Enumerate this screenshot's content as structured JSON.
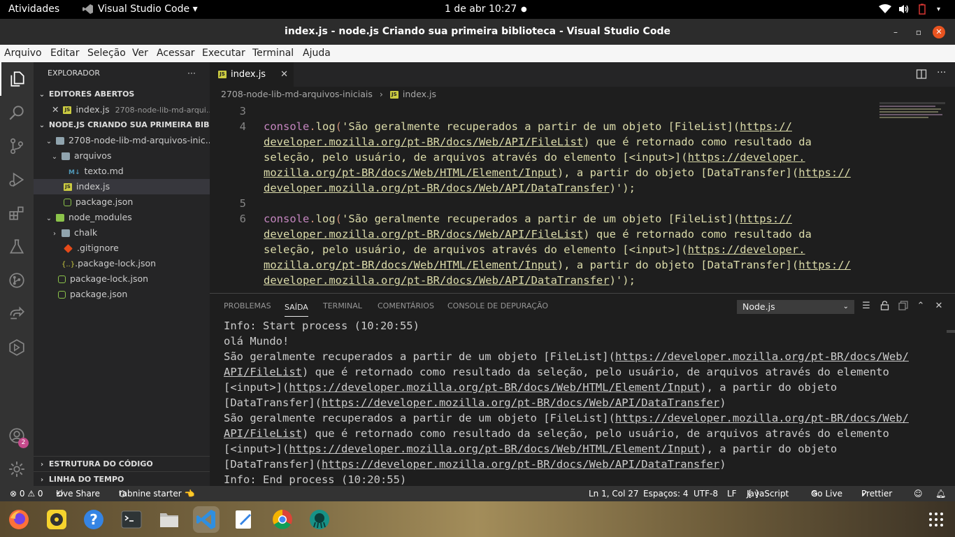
{
  "topbar": {
    "activities": "Atividades",
    "app_menu": "Visual Studio Code",
    "clock": "1 de abr  10:27"
  },
  "window": {
    "title": "index.js - node.js Criando sua primeira biblioteca - Visual Studio Code"
  },
  "menu": [
    "Arquivo",
    "Editar",
    "Seleção",
    "Ver",
    "Acessar",
    "Executar",
    "Terminal",
    "Ajuda"
  ],
  "activity_bar": {
    "accounts_badge": "2"
  },
  "sidebar": {
    "header": "EXPLORADOR",
    "more": "···",
    "open_editors_title": "EDITORES ABERTOS",
    "open_editor": {
      "name": "index.js",
      "path": "2708-node-lib-md-arqui..."
    },
    "project_title": "NODE.JS CRIANDO SUA PRIMEIRA BIBLIO...",
    "tree": [
      {
        "label": "2708-node-lib-md-arquivos-inic...",
        "kind": "folder",
        "depth": 1,
        "open": true
      },
      {
        "label": "arquivos",
        "kind": "folder",
        "depth": 2,
        "open": true
      },
      {
        "label": "texto.md",
        "kind": "md",
        "depth": 3
      },
      {
        "label": "index.js",
        "kind": "js",
        "depth": 2,
        "selected": true
      },
      {
        "label": "package.json",
        "kind": "npm",
        "depth": 2
      },
      {
        "label": "node_modules",
        "kind": "folder",
        "depth": 1,
        "open": true
      },
      {
        "label": "chalk",
        "kind": "folder",
        "depth": 2,
        "open": false
      },
      {
        "label": ".gitignore",
        "kind": "git",
        "depth": 2
      },
      {
        "label": ".package-lock.json",
        "kind": "jsonlock",
        "depth": 2
      },
      {
        "label": "package-lock.json",
        "kind": "npm",
        "depth": 1
      },
      {
        "label": "package.json",
        "kind": "npm",
        "depth": 1
      }
    ],
    "outline_title": "ESTRUTURA DO CÓDIGO",
    "timeline_title": "LINHA DO TEMPO"
  },
  "editor": {
    "tab": "index.js",
    "breadcrumb": {
      "folder": "2708-node-lib-md-arquivos-iniciais",
      "file": "index.js"
    },
    "lines": [
      {
        "num": "3",
        "text": ""
      },
      {
        "num": "4",
        "text": "console.log('São geralmente recuperados a partir de um objeto [FileList](https://",
        "first": true
      },
      {
        "num": "",
        "text": "developer.mozilla.org/pt-BR/docs/Web/API/FileList) que é retornado como resultado da"
      },
      {
        "num": "",
        "text": "seleção, pelo usuário, de arquivos através do elemento [<input>](https://developer."
      },
      {
        "num": "",
        "text": "mozilla.org/pt-BR/docs/Web/HTML/Element/Input), a partir do objeto [DataTransfer](https://"
      },
      {
        "num": "",
        "text": "developer.mozilla.org/pt-BR/docs/Web/API/DataTransfer)');"
      },
      {
        "num": "5",
        "text": ""
      },
      {
        "num": "6",
        "text": "console.log('São geralmente recuperados a partir de um objeto [FileList](https://",
        "first": true
      },
      {
        "num": "",
        "text": "developer.mozilla.org/pt-BR/docs/Web/API/FileList) que é retornado como resultado da"
      },
      {
        "num": "",
        "text": "seleção, pelo usuário, de arquivos através do elemento [<input>](https://developer."
      },
      {
        "num": "",
        "text": "mozilla.org/pt-BR/docs/Web/HTML/Element/Input), a partir do objeto [DataTransfer](https://"
      },
      {
        "num": "",
        "text": "developer.mozilla.org/pt-BR/docs/Web/API/DataTransfer)');"
      }
    ]
  },
  "panel": {
    "tabs": [
      "PROBLEMAS",
      "SAÍDA",
      "TERMINAL",
      "COMENTÁRIOS",
      "CONSOLE DE DEPURAÇÃO"
    ],
    "active_tab": "SAÍDA",
    "channel": "Node.js",
    "output": [
      "Info: Start process (10:20:55)",
      "olá Mundo!",
      "São geralmente recuperados a partir de um objeto [FileList](https://developer.mozilla.org/pt-BR/docs/Web/",
      "API/FileList) que é retornado como resultado da seleção, pelo usuário, de arquivos através do elemento",
      "[<input>](https://developer.mozilla.org/pt-BR/docs/Web/HTML/Element/Input), a partir do objeto",
      "[DataTransfer](https://developer.mozilla.org/pt-BR/docs/Web/API/DataTransfer)",
      "São geralmente recuperados a partir de um objeto [FileList](https://developer.mozilla.org/pt-BR/docs/Web/",
      "API/FileList) que é retornado como resultado da seleção, pelo usuário, de arquivos através do elemento",
      "[<input>](https://developer.mozilla.org/pt-BR/docs/Web/HTML/Element/Input), a partir do objeto",
      "[DataTransfer](https://developer.mozilla.org/pt-BR/docs/Web/API/DataTransfer)",
      "Info: End process (10:20:55)"
    ]
  },
  "statusbar": {
    "problems": "⊗ 0 ⚠ 0",
    "liveshare": "Live Share",
    "tabnine": "tabnine starter 👈",
    "position": "Ln 1, Col 27",
    "spaces": "Espaços: 4",
    "encoding": "UTF-8",
    "eol": "LF",
    "language": "JavaScript",
    "golive": "Go Live",
    "prettier": "Prettier"
  },
  "colors": {
    "activity_bar": "#333333",
    "sidebar": "#252526",
    "editor": "#1e1e1e",
    "string": "#ce9178",
    "keyword": "#c586c0",
    "function": "#dcdcaa",
    "statusbar": "#333333"
  },
  "dock": [
    "firefox-icon",
    "rhythmbox-icon",
    "help-icon",
    "terminal-icon",
    "files-icon",
    "vscode-icon",
    "text-editor-icon",
    "chrome-icon",
    "gitkraken-icon",
    "app-grid-icon"
  ]
}
